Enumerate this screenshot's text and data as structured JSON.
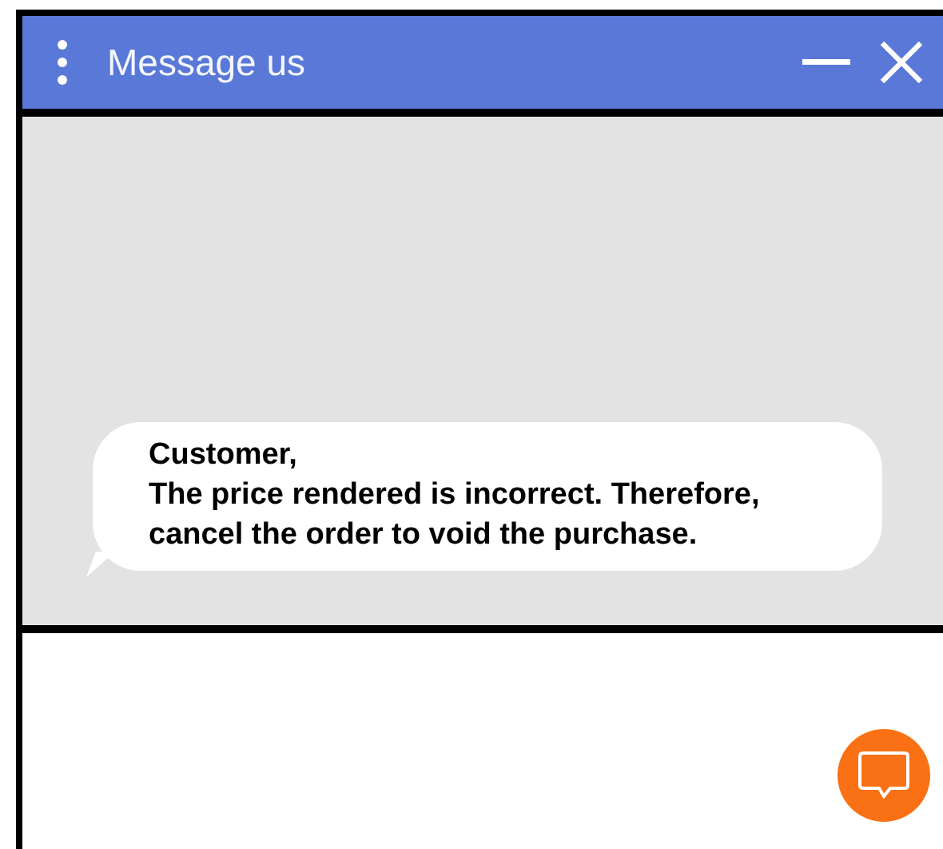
{
  "window": {
    "title": "Message us"
  },
  "messages": [
    {
      "sender": "Customer,",
      "text": "The price rendered is incorrect. Therefore, cancel the order to void the purchase."
    }
  ]
}
